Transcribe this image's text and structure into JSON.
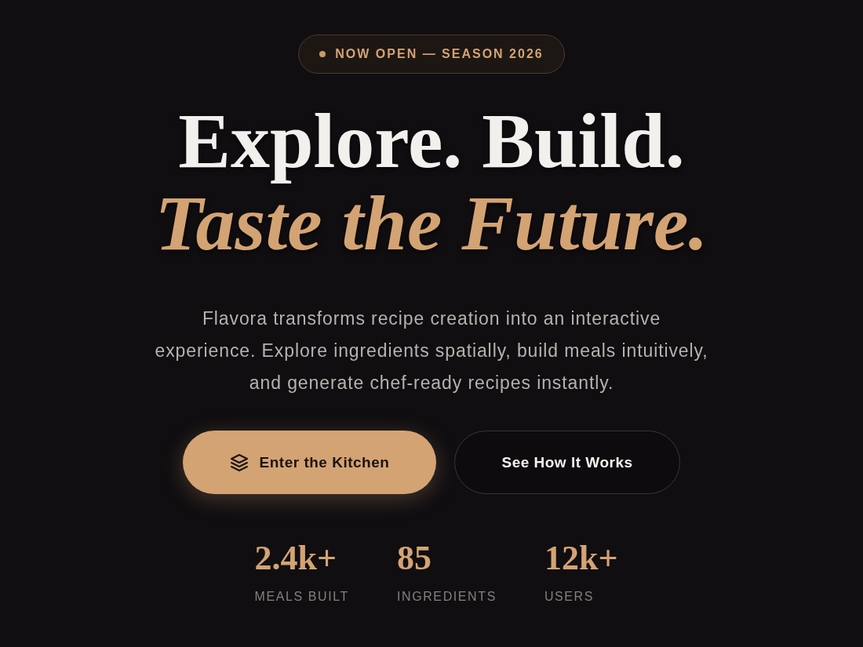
{
  "badge": {
    "text": "NOW OPEN — SEASON 2026"
  },
  "headline": {
    "line_1": "Explore. Build.",
    "line_2": "Taste the Future."
  },
  "description": "Flavora transforms recipe creation into an interactive experience. Explore ingredients spatially, build meals intuitively, and generate chef-ready recipes instantly.",
  "buttons": [
    {
      "label": "Enter the Kitchen",
      "kind": "primary"
    },
    {
      "label": "See How It Works",
      "kind": "secondary"
    }
  ],
  "stats": [
    {
      "value": "2.4k+",
      "label": "MEALS BUILT"
    },
    {
      "value": "85",
      "label": "INGREDIENTS"
    },
    {
      "value": "12k+",
      "label": "USERS"
    }
  ]
}
